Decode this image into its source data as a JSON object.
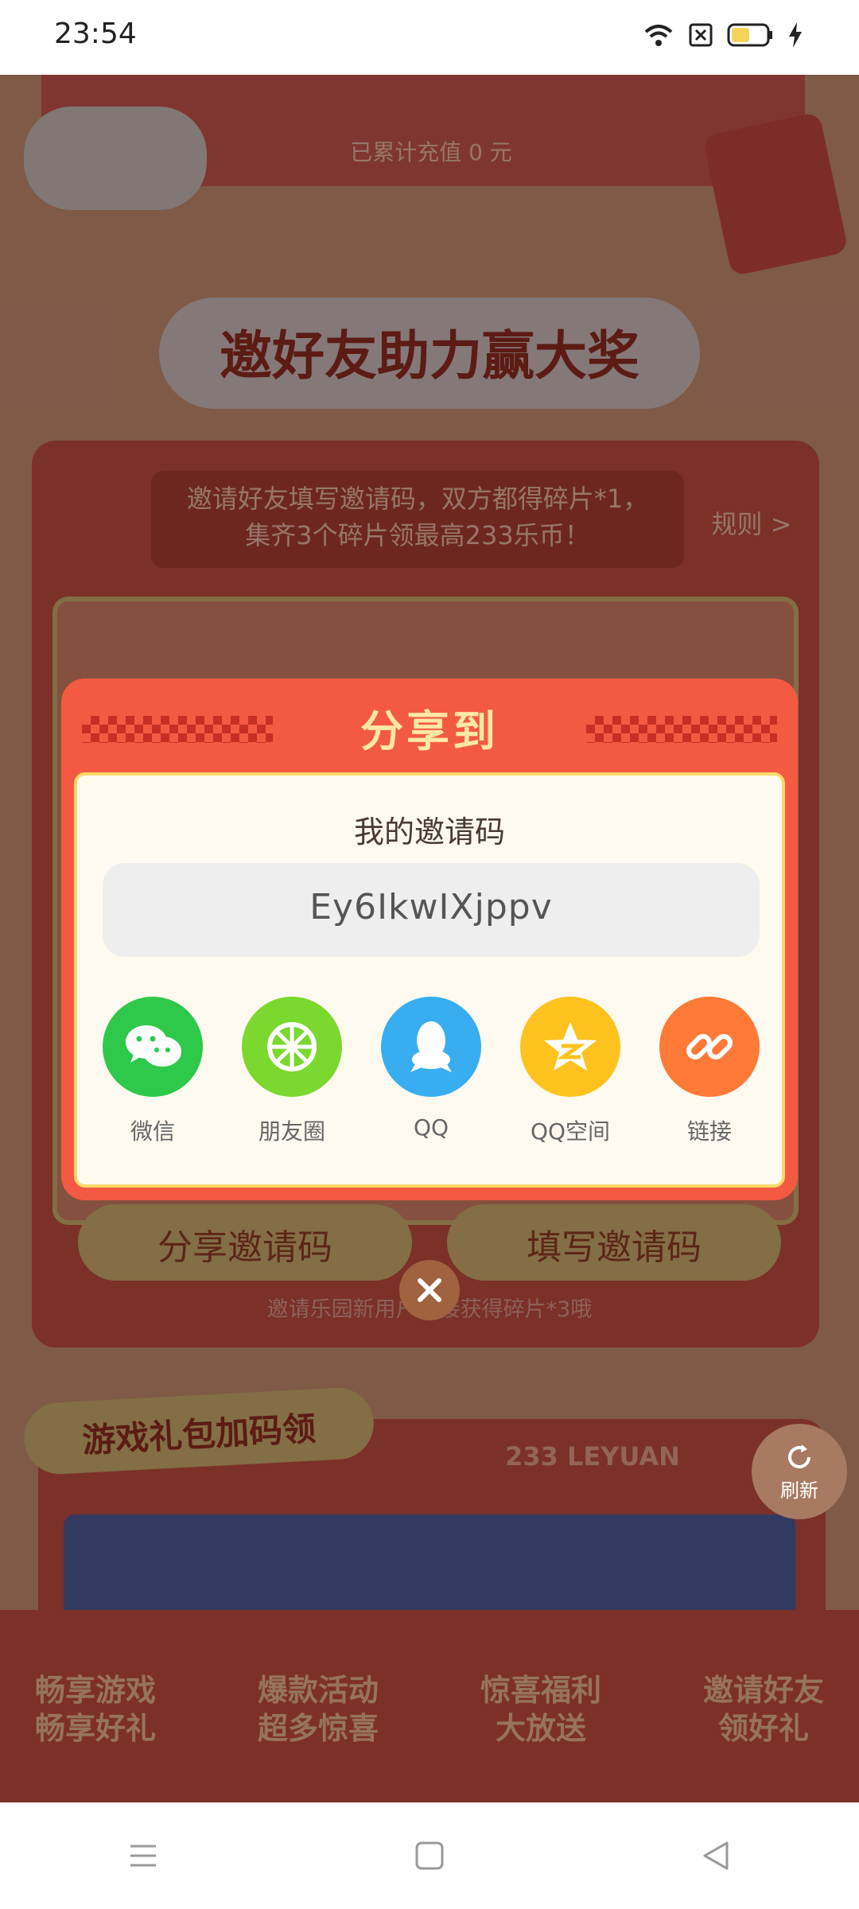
{
  "status_bar": {
    "time": "23:54",
    "icons": [
      "wifi-icon",
      "sim-blocked-icon",
      "battery-icon",
      "charging-icon"
    ]
  },
  "background": {
    "recharge_text": "已累计充值 0 元",
    "section_title": "邀好友助力赢大奖",
    "invite_description": "邀请好友填写邀请码，双方都得碎片*1，集齐3个碎片领最高233乐币！",
    "rules_link": "规则 >",
    "share_code_button": "分享邀请码",
    "fill_code_button": "填写邀请码",
    "bottom_note": "邀请乐园新用户直接获得碎片*3哦",
    "gift_section_title": "游戏礼包加码领",
    "brand_text": "233 LEYUAN",
    "promo_items": [
      {
        "line1": "畅享游戏",
        "line2": "畅享好礼"
      },
      {
        "line1": "爆款活动",
        "line2": "超多惊喜"
      },
      {
        "line1": "惊喜福利",
        "line2": "大放送"
      },
      {
        "line1": "邀请好友",
        "line2": "领好礼"
      }
    ]
  },
  "dialog": {
    "title": "分享到",
    "invite_label": "我的邀请码",
    "invite_code": "Ey6IkwIXjppv",
    "share_targets": [
      {
        "label": "微信",
        "icon": "wechat-icon",
        "color": "#2ec94a"
      },
      {
        "label": "朋友圈",
        "icon": "moments-icon",
        "color": "#7ad82e"
      },
      {
        "label": "QQ",
        "icon": "qq-icon",
        "color": "#38aef0"
      },
      {
        "label": "QQ空间",
        "icon": "qzone-icon",
        "color": "#ffc21e"
      },
      {
        "label": "链接",
        "icon": "link-icon",
        "color": "#ff7a36"
      }
    ]
  },
  "refresh_button": {
    "label": "刷新"
  },
  "nav_bar": {
    "buttons": [
      "menu-icon",
      "home-icon",
      "back-icon"
    ]
  }
}
